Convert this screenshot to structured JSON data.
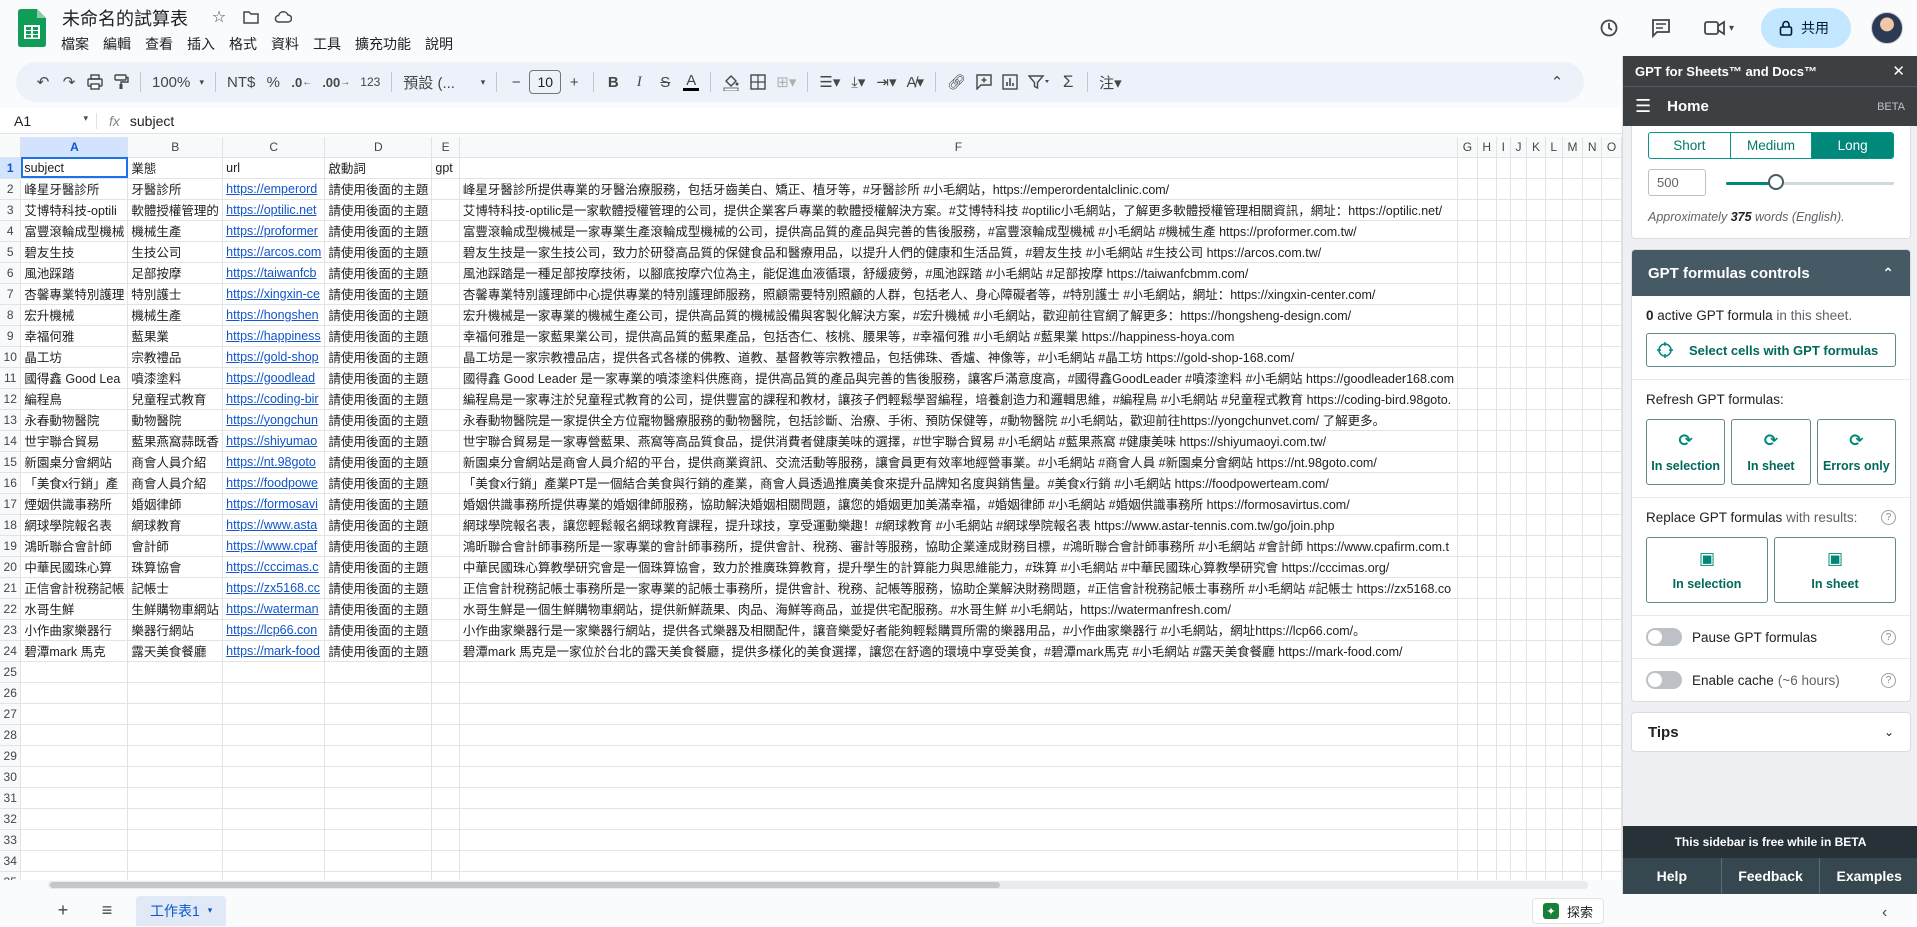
{
  "app": {
    "doc_title": "未命名的試算表",
    "menu": [
      "檔案",
      "編輯",
      "查看",
      "插入",
      "格式",
      "資料",
      "工具",
      "擴充功能",
      "說明"
    ],
    "share_label": "共用"
  },
  "toolbar": {
    "zoom": "100%",
    "currency": "NT$",
    "percent": "%",
    "dec_less": ".0",
    "dec_more": ".00",
    "num_format": "123",
    "font": "預設 (...",
    "font_size": "10"
  },
  "formula_bar": {
    "cell_ref": "A1",
    "fx": "fx",
    "content": "subject"
  },
  "sheet": {
    "columns": [
      "A",
      "B",
      "C",
      "D",
      "E",
      "F",
      "G",
      "H",
      "I",
      "J",
      "K",
      "L",
      "M",
      "N",
      "O"
    ],
    "rows": [
      {
        "a": "subject",
        "b": "業態",
        "c": "url",
        "d": "啟動詞",
        "e": "gpt",
        "f": ""
      },
      {
        "a": "峰星牙醫診所",
        "b": "牙醫診所",
        "c": "https://emperord",
        "d": "請使用後面的主題",
        "e": "",
        "f": "峰星牙醫診所提供專業的牙醫治療服務，包括牙齒美白、矯正、植牙等，#牙醫診所 #小毛網站，https://emperordentalclinic.com/"
      },
      {
        "a": "艾博特科技-optili",
        "b": "軟體授權管理的",
        "c": "https://optilic.net",
        "d": "請使用後面的主題",
        "e": "",
        "f": "艾博特科技-optilic是一家軟體授權管理的公司，提供企業客戶專業的軟體授權解決方案。#艾博特科技 #optilic小毛網站，了解更多軟體授權管理相關資訊，網址：https://optilic.net/"
      },
      {
        "a": "富豐滾輪成型機械",
        "b": "機械生產",
        "c": "https://proformer",
        "d": "請使用後面的主題",
        "e": "",
        "f": "富豐滾輪成型機械是一家專業生產滾輪成型機械的公司，提供高品質的產品與完善的售後服務，#富豐滾輪成型機械 #小毛網站 #機械生產 https://proformer.com.tw/"
      },
      {
        "a": "碧友生技",
        "b": "生技公司",
        "c": "https://arcos.com",
        "d": "請使用後面的主題",
        "e": "",
        "f": "碧友生技是一家生技公司，致力於研發高品質的保健食品和醫療用品，以提升人們的健康和生活品質，#碧友生技 #小毛網站 #生技公司 https://arcos.com.tw/"
      },
      {
        "a": "風池踩踏",
        "b": "足部按摩",
        "c": "https://taiwanfcb",
        "d": "請使用後面的主題",
        "e": "",
        "f": "風池踩踏是一種足部按摩技術，以腳底按摩穴位為主，能促進血液循環，舒緩疲勞，#風池踩踏 #小毛網站 #足部按摩 https://taiwanfcbmm.com/"
      },
      {
        "a": "杏馨專業特別護理",
        "b": "特別護士",
        "c": "https://xingxin-ce",
        "d": "請使用後面的主題",
        "e": "",
        "f": "杏馨專業特別護理師中心提供專業的特別護理師服務，照顧需要特別照顧的人群，包括老人、身心障礙者等，#特別護士 #小毛網站，網址：https://xingxin-center.com/"
      },
      {
        "a": "宏升機械",
        "b": "機械生產",
        "c": "https://hongshen",
        "d": "請使用後面的主題",
        "e": "",
        "f": "宏升機械是一家專業的機械生產公司，提供高品質的機械設備與客製化解決方案，#宏升機械 #小毛網站，歡迎前往官網了解更多：https://hongsheng-design.com/"
      },
      {
        "a": "幸福何雅",
        "b": "藍果業",
        "c": "https://happiness",
        "d": "請使用後面的主題",
        "e": "",
        "f": "幸福何雅是一家藍果業公司，提供高品質的藍果產品，包括杏仁、核桃、腰果等，#幸福何雅 #小毛網站 #藍果業 https://happiness-hoya.com"
      },
      {
        "a": "晶工坊",
        "b": "宗教禮品",
        "c": "https://gold-shop",
        "d": "請使用後面的主題",
        "e": "",
        "f": "晶工坊是一家宗教禮品店，提供各式各樣的佛教、道教、基督教等宗教禮品，包括佛珠、香爐、神像等，#小毛網站 #晶工坊 https://gold-shop-168.com/"
      },
      {
        "a": "國得鑫 Good Lea",
        "b": "噴漆塗料",
        "c": "https://goodlead",
        "d": "請使用後面的主題",
        "e": "",
        "f": "國得鑫 Good Leader 是一家專業的噴漆塗料供應商，提供高品質的產品與完善的售後服務，讓客戶滿意度高，#國得鑫GoodLeader #噴漆塗料 #小毛網站 https://goodleader168.com"
      },
      {
        "a": "編程鳥",
        "b": "兒童程式教育",
        "c": "https://coding-bir",
        "d": "請使用後面的主題",
        "e": "",
        "f": "編程鳥是一家專注於兒童程式教育的公司，提供豐富的課程和教材，讓孩子們輕鬆學習編程，培養創造力和邏輯思維，#編程鳥 #小毛網站 #兒童程式教育 https://coding-bird.98goto."
      },
      {
        "a": "永春動物醫院",
        "b": "動物醫院",
        "c": "https://yongchun",
        "d": "請使用後面的主題",
        "e": "",
        "f": "永春動物醫院是一家提供全方位寵物醫療服務的動物醫院，包括診斷、治療、手術、預防保健等，#動物醫院 #小毛網站，歡迎前往https://yongchunvet.com/ 了解更多。"
      },
      {
        "a": "世宇聯合貿易",
        "b": "藍果燕窩蒜既香",
        "c": "https://shiyumao",
        "d": "請使用後面的主題",
        "e": "",
        "f": "世宇聯合貿易是一家專營藍果、燕窩等高品質食品，提供消費者健康美味的選擇，#世宇聯合貿易 #小毛網站 #藍果燕窩 #健康美味 https://shiyumaoyi.com.tw/"
      },
      {
        "a": "新園桌分會網站",
        "b": "商會人員介紹",
        "c": "https://nt.98goto",
        "d": "請使用後面的主題",
        "e": "",
        "f": "新園桌分會網站是商會人員介紹的平台，提供商業資訊、交流活動等服務，讓會員更有效率地經營事業。#小毛網站 #商會人員 #新園桌分會網站 https://nt.98goto.com/"
      },
      {
        "a": "「美食x行銷」產",
        "b": "商會人員介紹",
        "c": "https://foodpowe",
        "d": "請使用後面的主題",
        "e": "",
        "f": "「美食x行銷」產業PT是一個結合美食與行銷的產業，商會人員透過推廣美食來提升品牌知名度與銷售量。#美食x行銷 #小毛網站 https://foodpowerteam.com/"
      },
      {
        "a": "煙姻供識事務所",
        "b": "婚姻律師",
        "c": "https://formosavi",
        "d": "請使用後面的主題",
        "e": "",
        "f": "婚姻供識事務所提供專業的婚姻律師服務，協助解決婚姻相關問題，讓您的婚姻更加美滿幸福，#婚姻律師 #小毛網站 #婚姻供識事務所 https://formosavirtus.com/"
      },
      {
        "a": "網球學院報名表",
        "b": "網球教育",
        "c": "https://www.asta",
        "d": "請使用後面的主題",
        "e": "",
        "f": "網球學院報名表，讓您輕鬆報名網球教育課程，提升球技，享受運動樂趣！#網球教育 #小毛網站 #網球學院報名表 https://www.astar-tennis.com.tw/go/join.php"
      },
      {
        "a": "鴻昕聯合會計師",
        "b": "會計師",
        "c": "https://www.cpaf",
        "d": "請使用後面的主題",
        "e": "",
        "f": "鴻昕聯合會計師事務所是一家專業的會計師事務所，提供會計、稅務、審計等服務，協助企業達成財務目標，#鴻昕聯合會計師事務所 #小毛網站 #會計師 https://www.cpafirm.com.t"
      },
      {
        "a": "中華民國珠心算",
        "b": "珠算協會",
        "c": "https://cccimas.c",
        "d": "請使用後面的主題",
        "e": "",
        "f": "中華民國珠心算教學研究會是一個珠算協會，致力於推廣珠算教育，提升學生的計算能力與思維能力，#珠算 #小毛網站 #中華民國珠心算教學研究會 https://cccimas.org/"
      },
      {
        "a": "正信會計稅務記帳",
        "b": "記帳士",
        "c": "https://zx5168.cc",
        "d": "請使用後面的主題",
        "e": "",
        "f": "正信會計稅務記帳士事務所是一家專業的記帳士事務所，提供會計、稅務、記帳等服務，協助企業解決財務問題，#正信會計稅務記帳士事務所 #小毛網站 #記帳士 https://zx5168.co"
      },
      {
        "a": "水哥生鮮",
        "b": "生鮮購物車網站",
        "c": "https://waterman",
        "d": "請使用後面的主題",
        "e": "",
        "f": "水哥生鮮是一個生鮮購物車網站，提供新鮮蔬果、肉品、海鮮等商品，並提供宅配服務。#水哥生鮮 #小毛網站，https://watermanfresh.com/"
      },
      {
        "a": "小作曲家樂器行",
        "b": "樂器行網站",
        "c": "https://lcp66.con",
        "d": "請使用後面的主題",
        "e": "",
        "f": "小作曲家樂器行是一家樂器行網站，提供各式樂器及相關配件，讓音樂愛好者能夠輕鬆購買所需的樂器用品，#小作曲家樂器行 #小毛網站，網址https://lcp66.com/。"
      },
      {
        "a": "碧潭mark 馬克",
        "b": "露天美食餐廳",
        "c": "https://mark-food",
        "d": "請使用後面的主題",
        "e": "",
        "f": "碧潭mark 馬克是一家位於台北的露天美食餐廳，提供多樣化的美食選擇，讓您在舒適的環境中享受美食，#碧潭mark馬克 #小毛網站 #露天美食餐廳 https://mark-food.com/"
      }
    ],
    "row_numbers": [
      "1",
      "2",
      "3",
      "4",
      "5",
      "6",
      "7",
      "8",
      "9",
      "10",
      "11",
      "12",
      "13",
      "14",
      "15",
      "16",
      "17",
      "18",
      "19",
      "20",
      "21",
      "22",
      "23",
      "24",
      "25",
      "26",
      "27",
      "28",
      "29",
      "30",
      "31",
      "32",
      "33",
      "34",
      "35"
    ],
    "tab_name": "工作表1",
    "explore_label": "探索"
  },
  "sidebar": {
    "title": "GPT for Sheets™ and Docs™",
    "nav_title": "Home",
    "beta": "BETA",
    "length": {
      "options": [
        "Short",
        "Medium",
        "Long"
      ],
      "selected": "Long",
      "value": "500",
      "slider_fraction": 0.3,
      "approx_prefix": "Approximately",
      "approx_words": "375",
      "approx_suffix": "words (English)."
    },
    "controls": {
      "title": "GPT formulas controls",
      "active_count": "0",
      "active_mid": "active GPT formula",
      "active_suffix": "in this sheet.",
      "select_cells": "Select cells with GPT formulas",
      "refresh_title": "Refresh GPT formulas:",
      "refresh_buttons": [
        "In selection",
        "In sheet",
        "Errors only"
      ],
      "replace_title": "Replace GPT formulas",
      "replace_suffix": "with results:",
      "replace_buttons": [
        "In selection",
        "In sheet"
      ],
      "pause_label": "Pause GPT formulas",
      "cache_label": "Enable cache",
      "cache_suffix": "(~6 hours)"
    },
    "tips": "Tips",
    "free_note": "This sidebar is free while in BETA",
    "footer": [
      "Help",
      "Feedback",
      "Examples"
    ]
  }
}
